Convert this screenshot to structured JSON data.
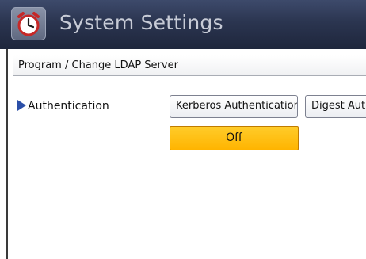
{
  "header": {
    "title": "System Settings",
    "icon": "clock-gear-icon"
  },
  "breadcrumb": {
    "text": "Program / Change LDAP Server"
  },
  "authentication": {
    "label": "Authentication",
    "options": {
      "kerberos": "Kerberos Authentication",
      "digest": "Digest Aut"
    },
    "selected_value": "Off"
  },
  "colors": {
    "header_bg": "#2b3550",
    "selected_option_bg": "#ffb400",
    "arrow": "#2b4fa8"
  }
}
